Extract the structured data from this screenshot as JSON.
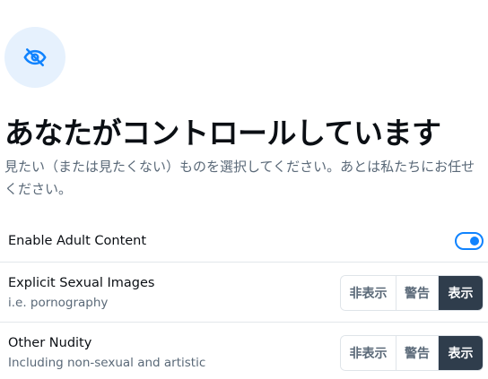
{
  "header": {
    "icon": "eye-slash-icon",
    "title": "あなたがコントロールしています",
    "subtitle": "見たい（または見たくない）ものを選択してください。あとは私たちにお任せください。"
  },
  "settings": {
    "adult": {
      "label": "Enable Adult Content",
      "enabled": true
    },
    "explicit": {
      "label": "Explicit Sexual Images",
      "description": "i.e. pornography",
      "options": [
        "非表示",
        "警告",
        "表示"
      ],
      "selected": "表示"
    },
    "nudity": {
      "label": "Other Nudity",
      "description": "Including non-sexual and artistic",
      "options": [
        "非表示",
        "警告",
        "表示"
      ],
      "selected": "表示"
    }
  },
  "colors": {
    "accent": "#1083fe",
    "icon_bg": "#e6f1fd",
    "selected_bg": "#2f3d4c",
    "muted_text": "#5a6978"
  }
}
